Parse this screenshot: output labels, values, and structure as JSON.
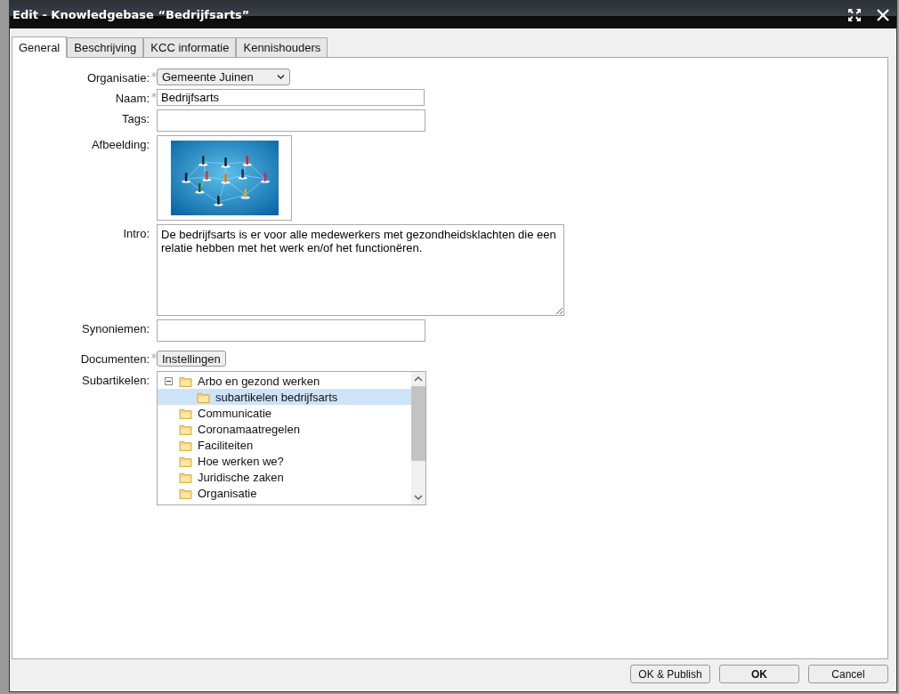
{
  "window": {
    "title": "Edit - Knowledgebase “Bedrijfsarts”"
  },
  "tabs": [
    {
      "label": "General",
      "selected": true
    },
    {
      "label": "Beschrijving",
      "selected": false
    },
    {
      "label": "KCC informatie",
      "selected": false
    },
    {
      "label": "Kennishouders",
      "selected": false
    }
  ],
  "form": [
    {
      "kind": "select",
      "label": "Organisatie:",
      "required": true,
      "value": "Gemeente Juinen"
    },
    {
      "kind": "text",
      "label": "Naam:",
      "required": true,
      "value": "Bedrijfsarts"
    },
    {
      "kind": "text",
      "label": "Tags:",
      "required": false
    },
    {
      "label": "Afbeelding:",
      "required": false
    },
    {
      "kind": "textarea",
      "label": "Intro:",
      "required": false,
      "value": "De bedrijfsarts is er voor alle medewerkers met gezondheidsklachten die een relatie hebben met het werk en/of het functionëren."
    },
    {
      "kind": "text",
      "label": "Synoniemen:",
      "required": false
    },
    {
      "kind": "button",
      "label": "Documenten:",
      "required": true,
      "value": "Instellingen"
    },
    {
      "kind": "tree",
      "label": "Subartikelen:",
      "required": false
    }
  ],
  "tree": [
    {
      "label": "Arbo en gezond werken",
      "expanded": true,
      "selected": false,
      "children": [
        {
          "label": "subartikelen bedrijfsarts",
          "selected": true
        }
      ]
    },
    {
      "label": "Communicatie",
      "selected": false
    },
    {
      "label": "Coronamaatregelen",
      "selected": false
    },
    {
      "label": "Faciliteiten",
      "selected": false
    },
    {
      "label": "Hoe werken we?",
      "selected": false
    },
    {
      "label": "Juridische zaken",
      "selected": false
    },
    {
      "label": "Organisatie",
      "selected": false
    }
  ],
  "buttons": [
    {
      "label": "OK & Publish",
      "primary": false
    },
    {
      "label": "OK",
      "primary": true
    },
    {
      "label": "Cancel",
      "primary": false
    }
  ]
}
